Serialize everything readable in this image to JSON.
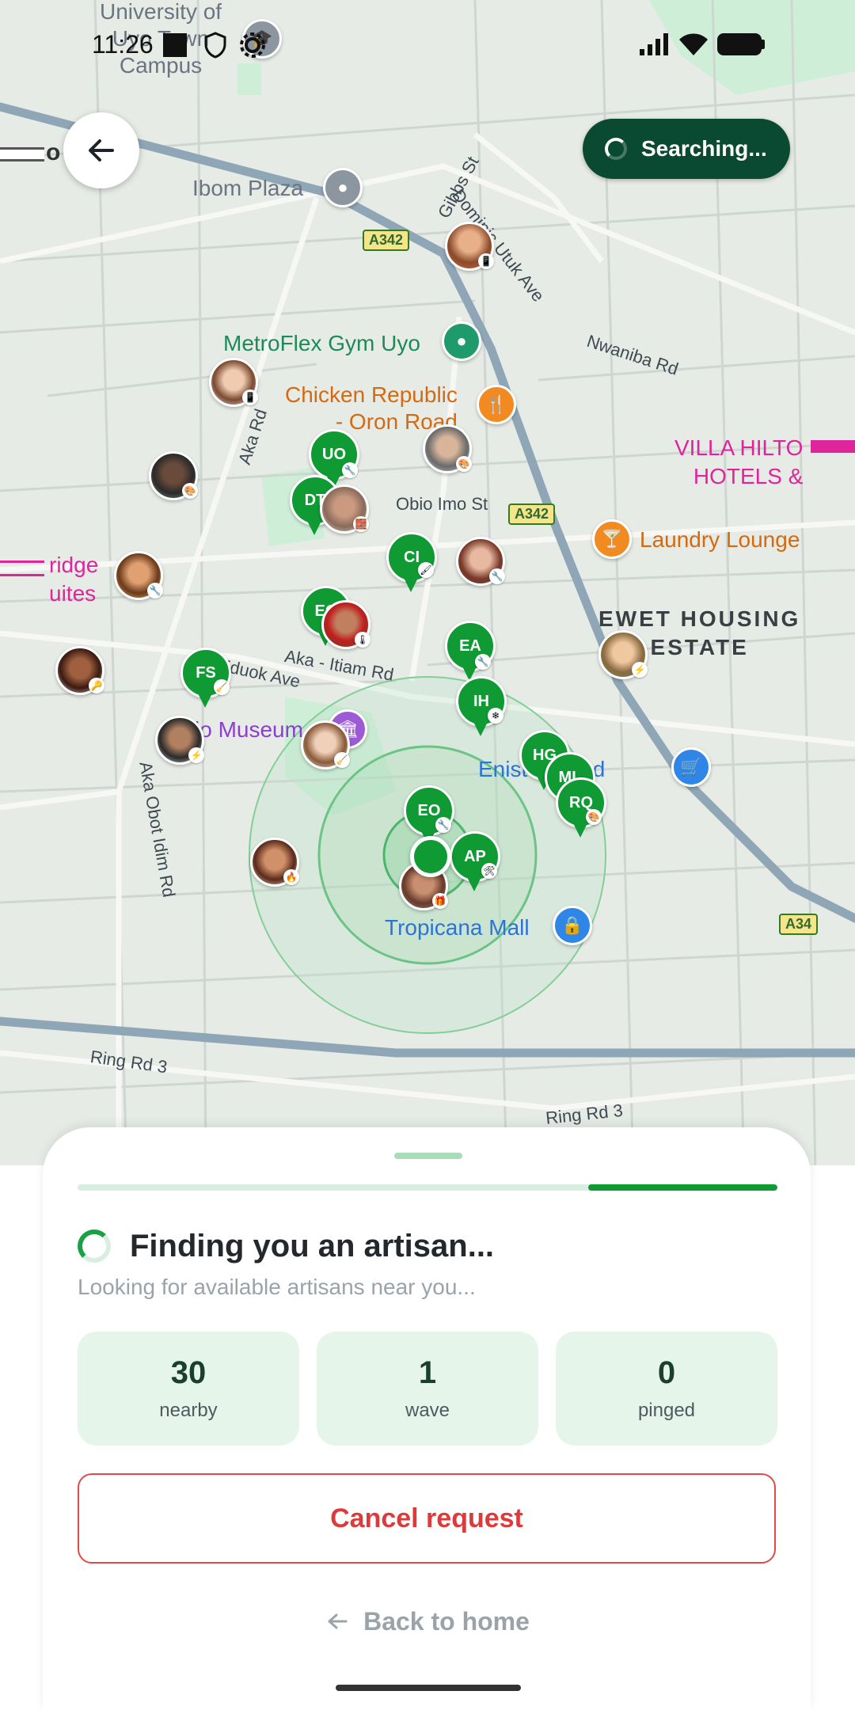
{
  "status_bar": {
    "time": "11:26"
  },
  "map": {
    "labels": {
      "university": "University of\nUyo Town\nCampus",
      "ibom_plaza": "Ibom Plaza",
      "metroflex": "MetroFlex Gym Uyo",
      "chicken_republic": "Chicken Republic\n- Oron Road",
      "villa_hilton": "VILLA HILTO\nHOTELS &",
      "laundry_lounge": "Laundry Lounge",
      "ewet": "EWET HOUSING\nESTATE",
      "bridge_suites": "ridge\nuites",
      "museum": "io Museum",
      "enist": "Enist   Limited",
      "tropicana": "Tropicana Mall",
      "left_edge_o": "o"
    },
    "streets": {
      "dominic_utuk": "Dominic Utuk Ave",
      "nwaniba": "Nwaniba Rd",
      "aka_rd": "Aka Rd",
      "obio_imo": "Obio Imo St",
      "aka_itiam": "Aka - Itiam Rd",
      "aka_eduok": "Aka Eduok Ave",
      "aka_obot": "Aka Obot Idim Rd",
      "ring_rd_3a": "Ring Rd 3",
      "ring_rd_3b": "Ring Rd 3",
      "gibbs_st": "Gibbs St"
    },
    "shields": {
      "a342_1": "A342",
      "a342_2": "A342",
      "a34": "A34"
    },
    "artisan_pins": [
      {
        "initials": "UO"
      },
      {
        "initials": "DT"
      },
      {
        "initials": "CI"
      },
      {
        "initials": "EO"
      },
      {
        "initials": "FS"
      },
      {
        "initials": "EA"
      },
      {
        "initials": "IH"
      },
      {
        "initials": "HG"
      },
      {
        "initials": "ML"
      },
      {
        "initials": "RQ"
      },
      {
        "initials": "EO"
      },
      {
        "initials": "AP"
      }
    ],
    "artisan_count": 30
  },
  "header": {
    "back_icon": "arrow-left-icon",
    "searching_label": "Searching..."
  },
  "sheet": {
    "progress": 0.27,
    "title": "Finding you an artisan...",
    "subtitle": "Looking for available artisans near you...",
    "stats": [
      {
        "value": "30",
        "label": "nearby"
      },
      {
        "value": "1",
        "label": "wave"
      },
      {
        "value": "0",
        "label": "pinged"
      }
    ],
    "cancel_label": "Cancel request",
    "back_home_label": "Back to home"
  },
  "colors": {
    "brand_dark": "#0a4a32",
    "pin_green": "#0f9a33",
    "cancel_red": "#dd3b3b",
    "stat_bg": "#e6f5ea"
  }
}
